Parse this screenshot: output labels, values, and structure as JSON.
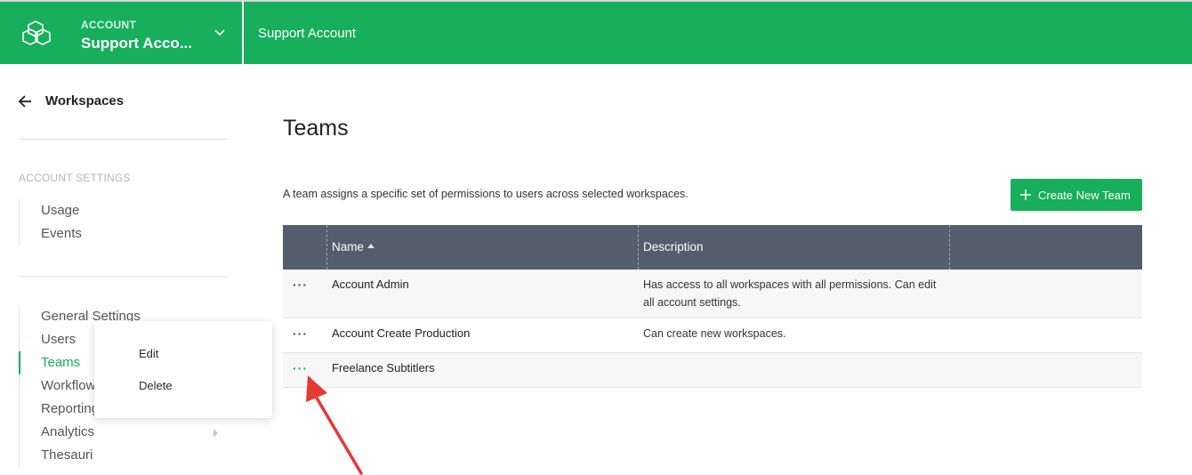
{
  "header": {
    "account_label": "ACCOUNT",
    "account_name": "Support Acco...",
    "title": "Support Account",
    "brand_color": "#17ae5c",
    "icons": {
      "logo": "hexagon-logo-icon",
      "chevron": "chevron-down-icon"
    }
  },
  "sidebar": {
    "back_label": "Workspaces",
    "back_icon": "arrow-left-icon",
    "section_label": "ACCOUNT SETTINGS",
    "group1": [
      {
        "label": "Usage"
      },
      {
        "label": "Events"
      }
    ],
    "group2": [
      {
        "label": "General Settings"
      },
      {
        "label": "Users"
      },
      {
        "label": "Teams",
        "active": true
      },
      {
        "label": "Workflows"
      },
      {
        "label": "Reporting"
      },
      {
        "label": "Analytics"
      },
      {
        "label": "Thesauri"
      }
    ]
  },
  "context_menu": {
    "items": [
      {
        "label": "Edit"
      },
      {
        "label": "Delete"
      }
    ]
  },
  "main": {
    "title": "Teams",
    "description": "A team assigns a specific set of permissions to users across selected workspaces.",
    "create_button": {
      "label": "Create New Team",
      "icon": "plus-icon"
    },
    "table": {
      "columns": [
        "Name",
        "Description"
      ],
      "sort_icon": "sort-ascending-icon",
      "rows": [
        {
          "actions": "···",
          "name": "Account Admin",
          "description": "Has access to all workspaces with all permissions. Can edit all account settings."
        },
        {
          "actions": "···",
          "name": "Account Create Production",
          "description": "Can create new workspaces."
        },
        {
          "actions": "···",
          "name": "Freelance Subtitlers",
          "description": ""
        }
      ]
    }
  },
  "annotation": {
    "icon": "red-arrow-icon",
    "color": "#e53935"
  }
}
